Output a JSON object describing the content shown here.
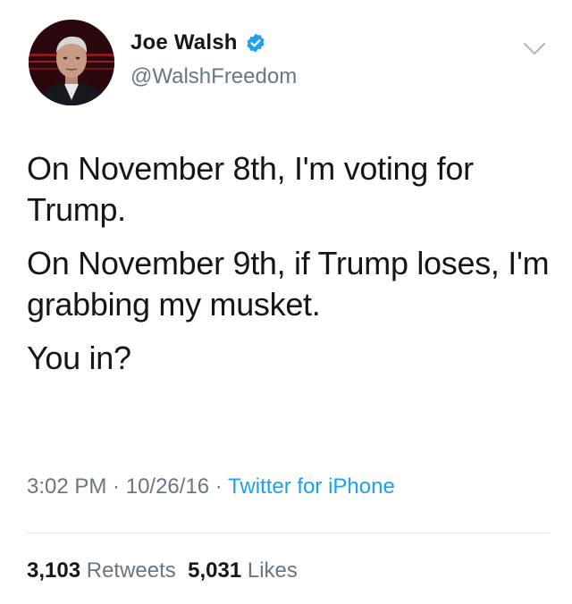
{
  "author": {
    "display_name": "Joe Walsh",
    "handle": "@WalshFreedom",
    "verified": true,
    "avatar_icon": "profile-photo"
  },
  "tweet": {
    "paragraphs": [
      "On November 8th, I'm voting for Trump.",
      "On November 9th, if Trump loses, I'm grabbing my musket.",
      "You in?"
    ]
  },
  "meta": {
    "time": "3:02 PM",
    "sep1": " · ",
    "date": "10/26/16",
    "sep2": " · ",
    "source": "Twitter for iPhone"
  },
  "stats": {
    "retweets_count": "3,103",
    "retweets_label": "Retweets",
    "likes_count": "5,031",
    "likes_label": "Likes"
  },
  "colors": {
    "text": "#14171a",
    "secondary": "#657786",
    "accent": "#1da1f2",
    "divider": "#e1e8ed"
  },
  "icons": {
    "verified": "verified-badge-icon",
    "menu": "chevron-down-icon"
  }
}
